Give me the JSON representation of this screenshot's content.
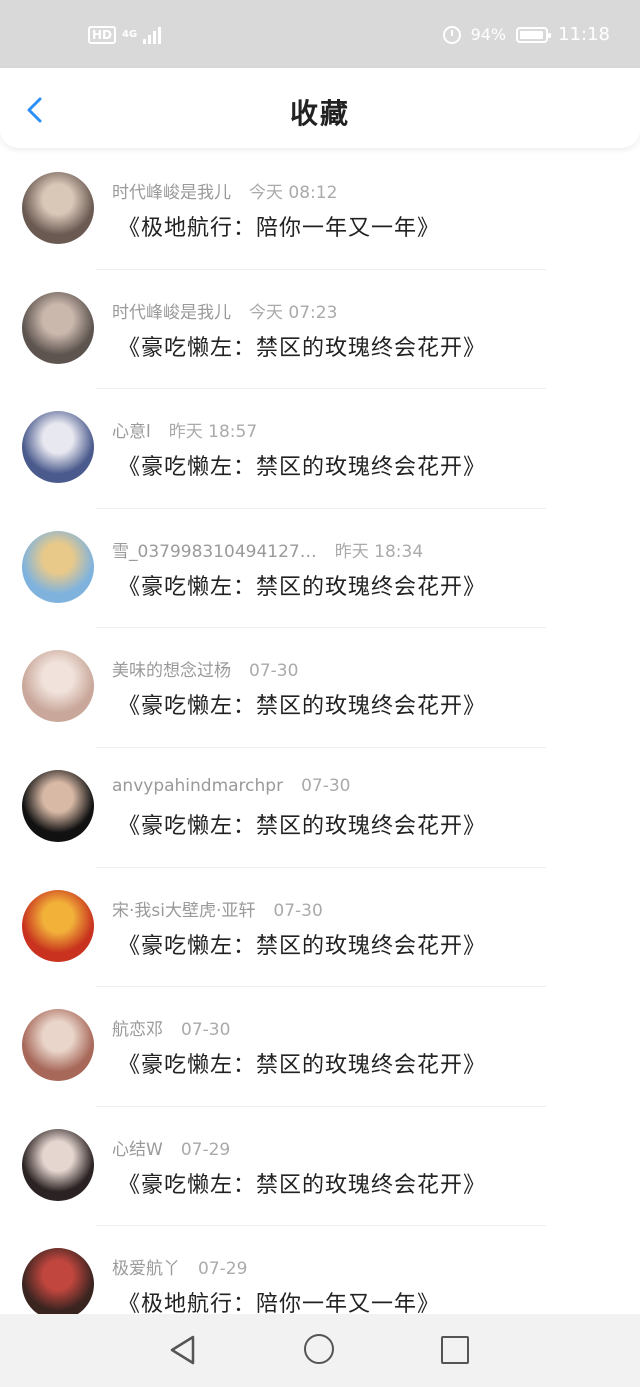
{
  "statusbar": {
    "hd": "HD",
    "network": "4G",
    "battery_percent": "94%",
    "battery_level": 0.94,
    "time": "11:18"
  },
  "header": {
    "title": "收藏"
  },
  "colors": {
    "accent": "#2c8ef8",
    "statusbar_bg": "#d9d9d9"
  },
  "items": [
    {
      "user": "时代峰峻是我儿",
      "time": "今天 08:12",
      "title": "《极地航行：陪你一年又一年》",
      "avatar_color": [
        "#6b5a52",
        "#d9c7b8"
      ]
    },
    {
      "user": "时代峰峻是我儿",
      "time": "今天 07:23",
      "title": "《豪吃懒左：禁区的玫瑰终会花开》",
      "avatar_color": [
        "#5d544f",
        "#cbb8ad"
      ]
    },
    {
      "user": "心意l",
      "time": "昨天 18:57",
      "title": "《豪吃懒左：禁区的玫瑰终会花开》",
      "avatar_color": [
        "#4a5a8c",
        "#e8e8f0"
      ]
    },
    {
      "user": "雪_037998310494127…",
      "time": "昨天 18:34",
      "title": "《豪吃懒左：禁区的玫瑰终会花开》",
      "avatar_color": [
        "#7fb3de",
        "#e8c98a"
      ]
    },
    {
      "user": "美味的想念过杨",
      "time": "07-30",
      "title": "《豪吃懒左：禁区的玫瑰终会花开》",
      "avatar_color": [
        "#c9a79a",
        "#f1e3dc"
      ]
    },
    {
      "user": "anvypahindmarchpr",
      "time": "07-30",
      "title": "《豪吃懒左：禁区的玫瑰终会花开》",
      "avatar_color": [
        "#111111",
        "#d8b9a6"
      ]
    },
    {
      "user": "宋·我si大壁虎·亚轩",
      "time": "07-30",
      "title": "《豪吃懒左：禁区的玫瑰终会花开》",
      "avatar_color": [
        "#c8321e",
        "#f2b23a"
      ]
    },
    {
      "user": "航恋邓",
      "time": "07-30",
      "title": "《豪吃懒左：禁区的玫瑰终会花开》",
      "avatar_color": [
        "#a7685a",
        "#e9d5c9"
      ]
    },
    {
      "user": "心结W",
      "time": "07-29",
      "title": "《豪吃懒左：禁区的玫瑰终会花开》",
      "avatar_color": [
        "#2b2323",
        "#e6d6d0"
      ]
    },
    {
      "user": "极爱航丫",
      "time": "07-29",
      "title": "《极地航行：陪你一年又一年》",
      "avatar_color": [
        "#3a2420",
        "#c0463e"
      ]
    }
  ]
}
